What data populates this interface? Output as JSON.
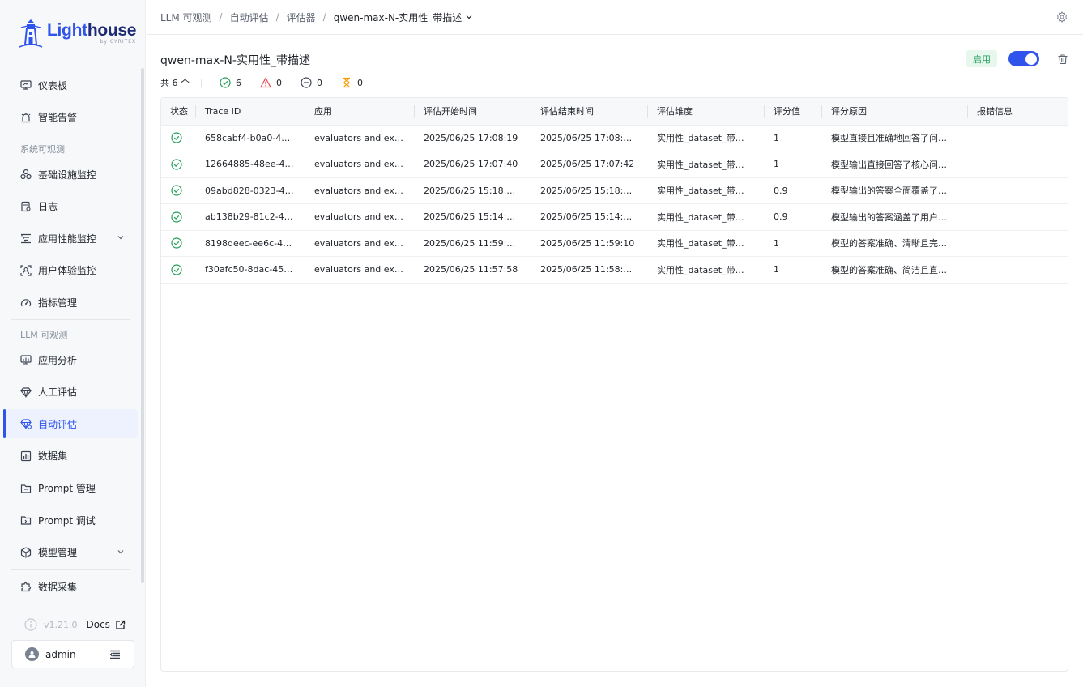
{
  "app": {
    "logo_text_a": "Lig",
    "logo_text_b": "ht",
    "logo_text_c": "house",
    "logo_sub": "by CYRITEX",
    "brand_color": "#2f54eb"
  },
  "sidebar": {
    "items_top": [
      {
        "label": "仪表板",
        "icon": "monitor-icon"
      },
      {
        "label": "智能告警",
        "icon": "alarm-icon"
      }
    ],
    "section_system": "系统可观测",
    "items_system": [
      {
        "label": "基础设施监控",
        "icon": "nodes-icon"
      },
      {
        "label": "日志",
        "icon": "log-icon"
      },
      {
        "label": "应用性能监控",
        "icon": "apm-icon",
        "expandable": true
      },
      {
        "label": "用户体验监控",
        "icon": "user-scan-icon"
      },
      {
        "label": "指标管理",
        "icon": "gauge-icon"
      }
    ],
    "section_llm": "LLM 可观测",
    "items_llm": [
      {
        "label": "应用分析",
        "icon": "chart-monitor-icon"
      },
      {
        "label": "人工评估",
        "icon": "diamond-icon"
      },
      {
        "label": "自动评估",
        "icon": "auto-eval-icon",
        "active": true
      },
      {
        "label": "数据集",
        "icon": "bar-chart-icon"
      },
      {
        "label": "Prompt 管理",
        "icon": "folder-icon"
      },
      {
        "label": "Prompt 调试",
        "icon": "folder-debug-icon"
      },
      {
        "label": "模型管理",
        "icon": "cube-icon",
        "expandable": true
      }
    ],
    "items_bottom": [
      {
        "label": "数据采集",
        "icon": "puzzle-icon"
      }
    ],
    "version": "v1.21.0",
    "docs_label": "Docs",
    "user_name": "admin"
  },
  "breadcrumb": [
    "LLM 可观测",
    "自动评估",
    "评估器",
    "qwen-max-N-实用性_带描述"
  ],
  "page": {
    "title": "qwen-max-N-实用性_带描述",
    "status_badge": "启用",
    "enabled": true,
    "total_label": "共 6 个",
    "stats": {
      "success": "6",
      "warning": "0",
      "skipped": "0",
      "pending": "0"
    }
  },
  "table": {
    "columns": [
      "状态",
      "Trace ID",
      "应用",
      "评估开始时间",
      "评估结束时间",
      "评估维度",
      "评分值",
      "评分原因",
      "报错信息"
    ],
    "rows": [
      {
        "status": "success",
        "trace_id": "658cabf4-b0a0-4…",
        "app": "evaluators and ex…",
        "start": "2025/06/25   17:08:19",
        "end": "2025/06/25   17:08:…",
        "dimension": "实用性_dataset_带…",
        "score": "1",
        "reason": "模型直接且准确地回答了问…",
        "error": ""
      },
      {
        "status": "success",
        "trace_id": "12664885-48ee-4…",
        "app": "evaluators and ex…",
        "start": "2025/06/25   17:07:40",
        "end": "2025/06/25   17:07:42",
        "dimension": "实用性_dataset_带…",
        "score": "1",
        "reason": "模型输出直接回答了核心问…",
        "error": ""
      },
      {
        "status": "success",
        "trace_id": "09abd828-0323-4…",
        "app": "evaluators and ex…",
        "start": "2025/06/25   15:18:…",
        "end": "2025/06/25   15:18:…",
        "dimension": "实用性_dataset_带…",
        "score": "0.9",
        "reason": "模型输出的答案全面覆盖了…",
        "error": ""
      },
      {
        "status": "success",
        "trace_id": "ab138b29-81c2-4…",
        "app": "evaluators and ex…",
        "start": "2025/06/25   15:14:…",
        "end": "2025/06/25   15:14:…",
        "dimension": "实用性_dataset_带…",
        "score": "0.9",
        "reason": "模型输出的答案涵盖了用户…",
        "error": ""
      },
      {
        "status": "success",
        "trace_id": "8198deec-ee6c-4…",
        "app": "evaluators and ex…",
        "start": "2025/06/25   11:59:…",
        "end": "2025/06/25   11:59:10",
        "dimension": "实用性_dataset_带…",
        "score": "1",
        "reason": "模型的答案准确、清晰且完…",
        "error": ""
      },
      {
        "status": "success",
        "trace_id": "f30afc50-8dac-45…",
        "app": "evaluators and ex…",
        "start": "2025/06/25   11:57:58",
        "end": "2025/06/25   11:58:…",
        "dimension": "实用性_dataset_带…",
        "score": "1",
        "reason": "模型的答案准确、简洁且直…",
        "error": ""
      }
    ]
  },
  "colors": {
    "success": "#22a05a",
    "warning": "#e5484d",
    "pending": "#f59e0b",
    "active_bg": "#eef2ff"
  }
}
